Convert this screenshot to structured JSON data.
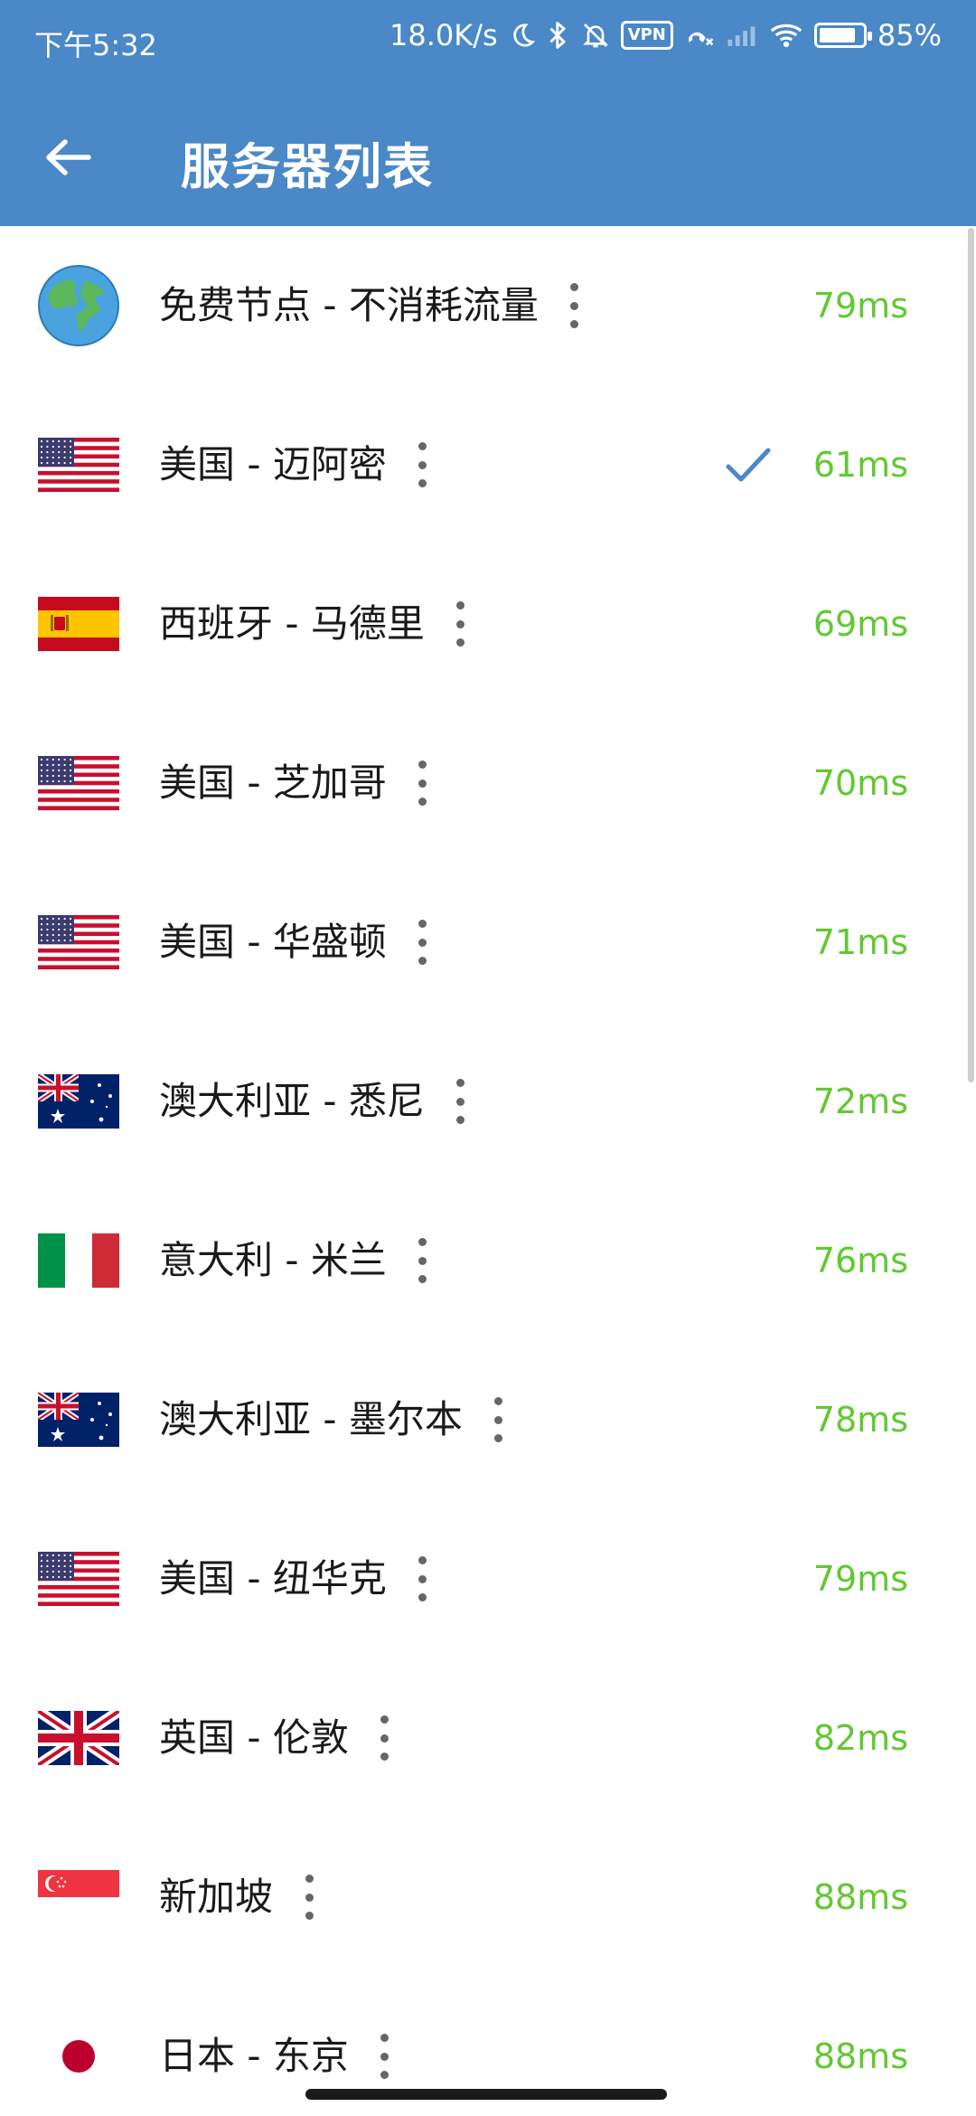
{
  "status_bar": {
    "time": "下午5:32",
    "network_speed": "18.0K/s",
    "vpn": "VPN",
    "battery": "85%",
    "battery_level": 0.85
  },
  "app_bar": {
    "title": "服务器列表",
    "back_icon": "arrow-left-icon"
  },
  "servers": [
    {
      "flag": "globe",
      "name": "免费节点 - 不消耗流量",
      "ping": "79ms",
      "selected": false
    },
    {
      "flag": "us",
      "name": "美国 - 迈阿密",
      "ping": "61ms",
      "selected": true
    },
    {
      "flag": "es",
      "name": "西班牙 - 马德里",
      "ping": "69ms",
      "selected": false
    },
    {
      "flag": "us",
      "name": "美国 - 芝加哥",
      "ping": "70ms",
      "selected": false
    },
    {
      "flag": "us",
      "name": "美国 - 华盛顿",
      "ping": "71ms",
      "selected": false
    },
    {
      "flag": "au",
      "name": "澳大利亚 - 悉尼",
      "ping": "72ms",
      "selected": false
    },
    {
      "flag": "it",
      "name": "意大利 - 米兰",
      "ping": "76ms",
      "selected": false
    },
    {
      "flag": "au",
      "name": "澳大利亚 - 墨尔本",
      "ping": "78ms",
      "selected": false
    },
    {
      "flag": "us",
      "name": "美国 - 纽华克",
      "ping": "79ms",
      "selected": false
    },
    {
      "flag": "gb",
      "name": "英国 - 伦敦",
      "ping": "82ms",
      "selected": false
    },
    {
      "flag": "sg",
      "name": "新加坡",
      "ping": "88ms",
      "selected": false
    },
    {
      "flag": "jp",
      "name": "日本 - 东京",
      "ping": "88ms",
      "selected": false
    }
  ],
  "colors": {
    "header": "#4a88c7",
    "ping": "#62c832",
    "check": "#4a88c7"
  }
}
